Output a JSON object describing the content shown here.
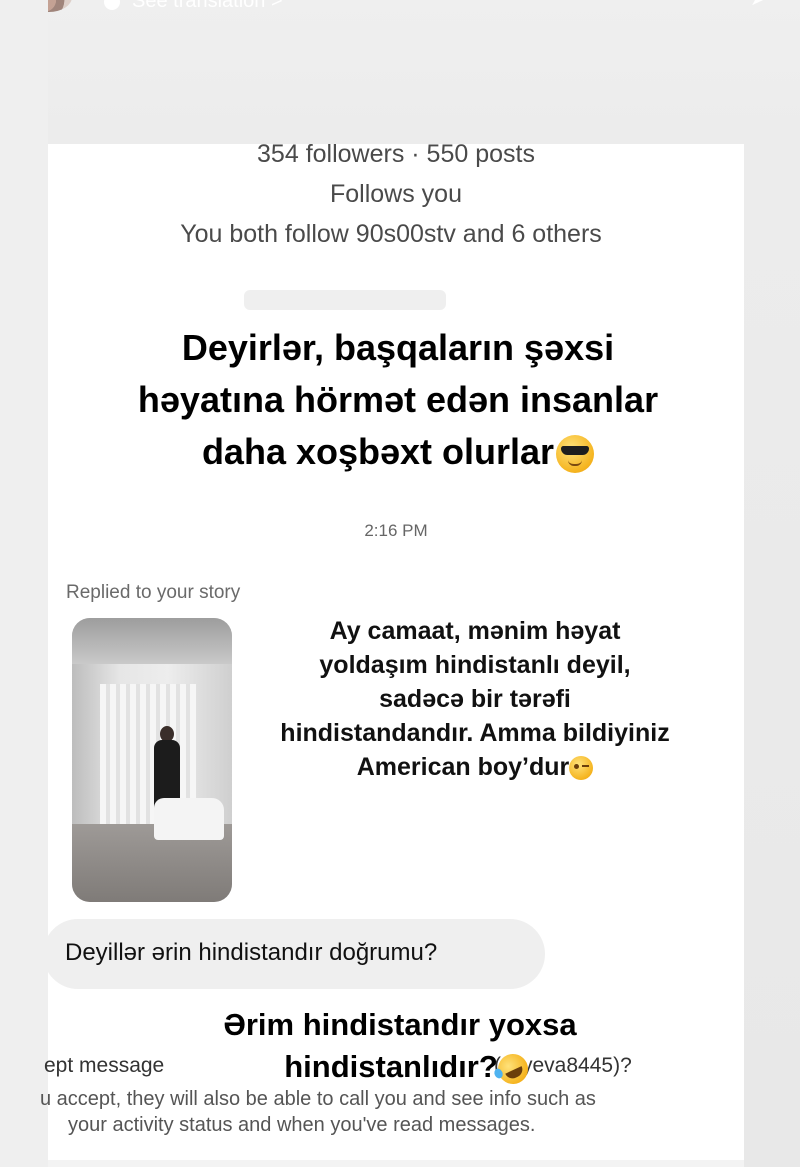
{
  "story_header": {
    "translate_label": "See translation >"
  },
  "profile": {
    "stats": "354 followers · 550 posts",
    "follow_status": "Follows you",
    "mutuals": "You both follow 90s00stv and 6 others"
  },
  "overlay": {
    "top_caption": "Deyirlər, başqaların şəxsi həyatına hörmət edən insanlar daha xoşbəxt olurlar",
    "top_caption_emoji": "smiling-face-with-sunglasses",
    "reply_text": "Ay camaat, mənim həyat yoldaşım hindistanlı deyil, sadəcə bir tərəfi hindistandandır. Amma bildiyiniz American boy’dur",
    "reply_emoji": "winking-face",
    "bottom_caption_line1": "Ərim hindistandır yoxsa",
    "bottom_caption_line2": "hindistanlıdır?",
    "bottom_caption_emoji": "rolling-on-floor-laughing"
  },
  "dm": {
    "timestamp": "2:16 PM",
    "replied_label": "Replied to your story",
    "question": "Deyillər ərin hindistandır doğrumu?",
    "accept_prefix": "ept message",
    "accept_suffix": "(aliyeva8445)?",
    "info_line1": "u accept, they will also be able to call you and see info such as",
    "info_line2": "your activity status and when you've read messages."
  }
}
